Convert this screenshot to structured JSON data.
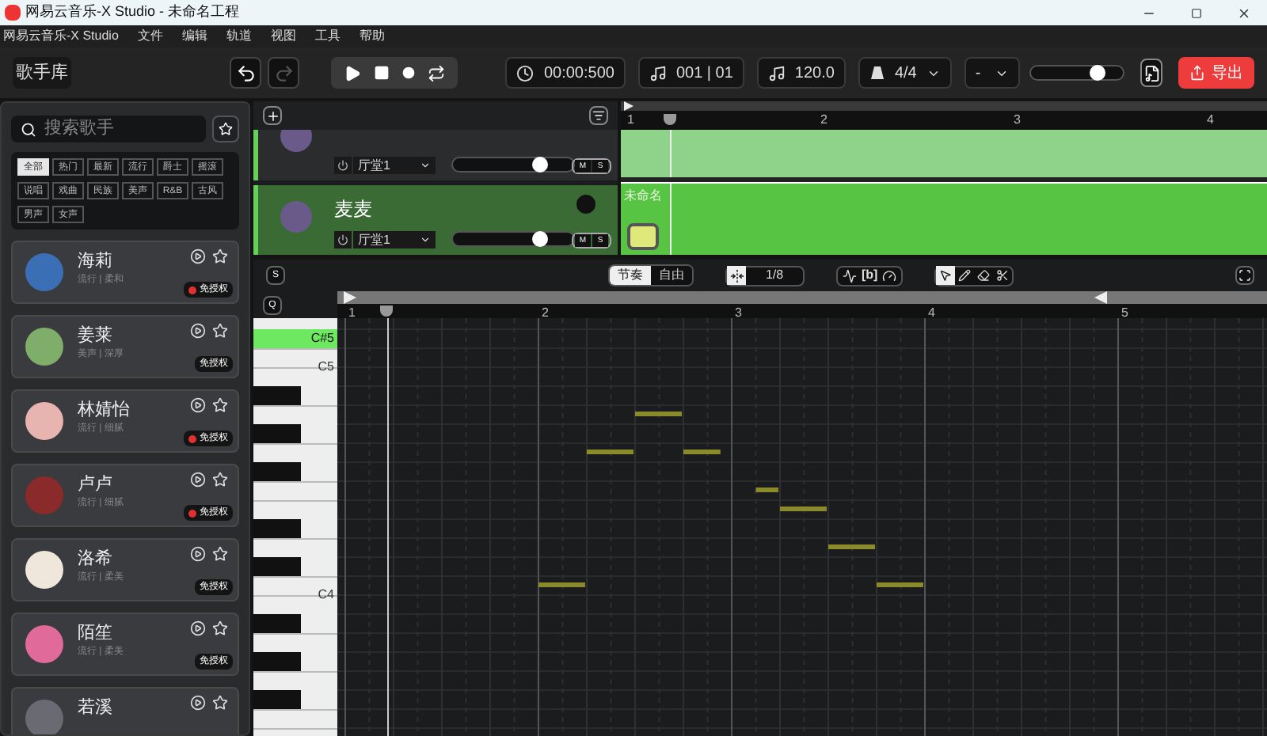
{
  "window": {
    "title": "网易云音乐-X Studio - 未命名工程"
  },
  "menu": [
    "网易云音乐-X Studio",
    "文件",
    "编辑",
    "轨道",
    "视图",
    "工具",
    "帮助"
  ],
  "toolbar": {
    "library_button": "歌手库",
    "undo": {
      "disabled": false
    },
    "redo": {
      "disabled": true
    },
    "time": "00:00:500",
    "position": "001 | 01",
    "tempo": "120.0",
    "meter": "4/4",
    "key": "-",
    "volume": {
      "level": 0.72
    },
    "export_button": "导出"
  },
  "singer_panel": {
    "search": {
      "placeholder": "搜索歌手"
    },
    "tags": [
      {
        "label": "全部",
        "selected": true
      },
      {
        "label": "热门",
        "selected": false
      },
      {
        "label": "最新",
        "selected": false
      },
      {
        "label": "流行",
        "selected": false
      },
      {
        "label": "爵士",
        "selected": false
      },
      {
        "label": "摇滚",
        "selected": false
      },
      {
        "label": "说唱",
        "selected": false
      },
      {
        "label": "戏曲",
        "selected": false
      },
      {
        "label": "民族",
        "selected": false
      },
      {
        "label": "美声",
        "selected": false
      },
      {
        "label": "R&B",
        "selected": false
      },
      {
        "label": "古风",
        "selected": false
      },
      {
        "label": "男声",
        "selected": false
      },
      {
        "label": "女声",
        "selected": false
      }
    ],
    "singers": [
      {
        "name": "海莉",
        "style": "流行 | 柔和",
        "badge": "免授权",
        "badge_dot": true,
        "color": "#3b6fb5"
      },
      {
        "name": "姜莱",
        "style": "美声 | 深厚",
        "badge": "免授权",
        "badge_dot": false,
        "color": "#7fae6a"
      },
      {
        "name": "林婧怡",
        "style": "流行 | 细腻",
        "badge": "免授权",
        "badge_dot": true,
        "color": "#e8b4b0"
      },
      {
        "name": "卢卢",
        "style": "流行 | 细腻",
        "badge": "免授权",
        "badge_dot": true,
        "color": "#8a2a2a"
      },
      {
        "name": "洛希",
        "style": "流行 | 柔美",
        "badge": "免授权",
        "badge_dot": false,
        "color": "#efe6dc"
      },
      {
        "name": "陌笙",
        "style": "流行 | 柔美",
        "badge": "免授权",
        "badge_dot": false,
        "color": "#e06a9a"
      },
      {
        "name": "若溪",
        "color": "#6a6b72"
      }
    ]
  },
  "tracks": [
    {
      "preset": "厅堂1",
      "volume": {
        "level": 0.72
      },
      "mute": "M",
      "solo": "S",
      "selected": false
    },
    {
      "name": "麦麦",
      "preset": "厅堂1",
      "volume": {
        "level": 0.72
      },
      "mute": "M",
      "solo": "S",
      "selected": true
    }
  ],
  "arrangement": {
    "ruler": [
      "1",
      "2",
      "3",
      "4"
    ],
    "region": {
      "label": "未命名"
    }
  },
  "editor": {
    "s_button": "S",
    "q_button": "Q",
    "modes": [
      {
        "label": "节奏",
        "selected": true
      },
      {
        "label": "自由",
        "selected": false
      }
    ],
    "quantize": "1/8",
    "breath_button": "[b]",
    "tools": [
      {
        "kind": "select",
        "selected": true
      },
      {
        "kind": "pencil",
        "selected": false
      },
      {
        "kind": "eraser",
        "selected": false
      },
      {
        "kind": "cut",
        "selected": false
      }
    ],
    "ruler": [
      "1",
      "2",
      "3",
      "4",
      "5"
    ],
    "keys": [
      {
        "label": "C#5",
        "selected": true
      },
      {
        "label": "C5",
        "selected": false
      },
      {
        "label": "C4",
        "selected": false
      }
    ]
  }
}
